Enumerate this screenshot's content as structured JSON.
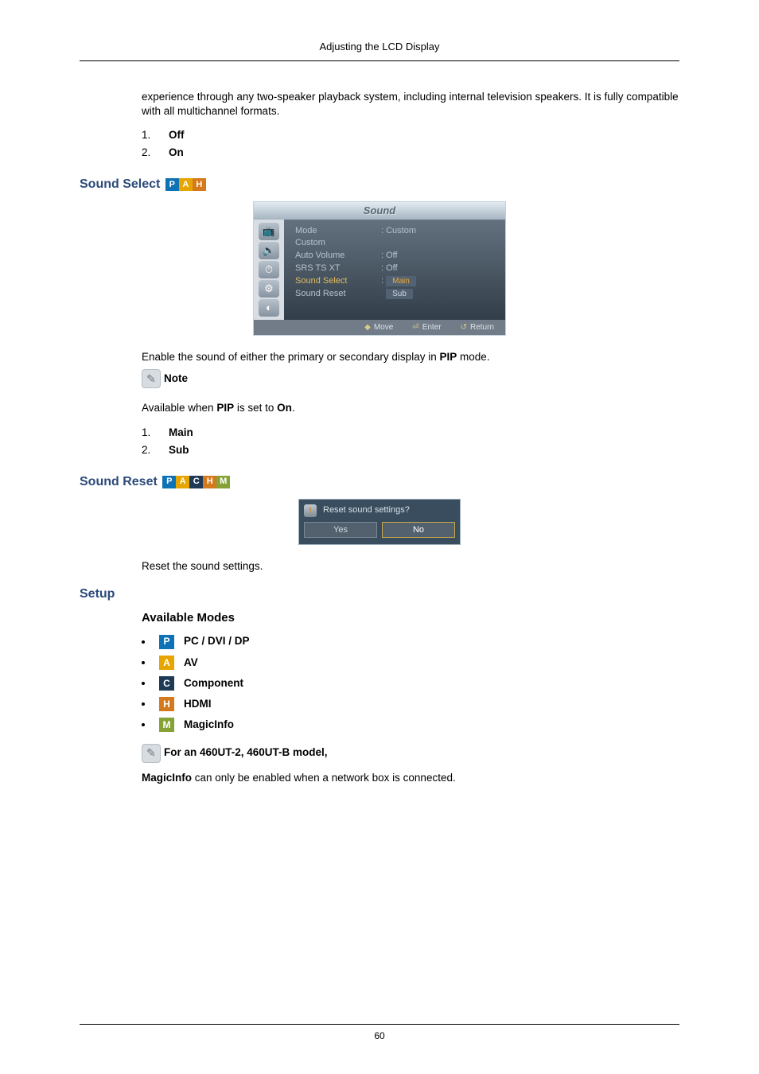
{
  "header": "Adjusting the LCD Display",
  "intro_paragraph": "experience through any two-speaker playback system, including internal television speakers. It is fully compatible with all multichannel formats.",
  "list_off_on": [
    "Off",
    "On"
  ],
  "sound_select": {
    "title": "Sound Select",
    "icons": [
      "P",
      "A",
      "H"
    ],
    "osd": {
      "title": "Sound",
      "rows": [
        {
          "k": "Mode",
          "v": ": Custom"
        },
        {
          "k": "Custom",
          "v": ""
        },
        {
          "k": "Auto Volume",
          "v": ": Off"
        },
        {
          "k": "SRS TS XT",
          "v": ": Off"
        },
        {
          "k": "Sound Select",
          "v_main": "Main",
          "highlight": true
        },
        {
          "k": "Sound Reset",
          "v_sub": "Sub"
        }
      ],
      "footer": {
        "move": "Move",
        "enter": "Enter",
        "return": "Return"
      }
    },
    "after_text": "Enable the sound of either the primary or secondary display in ",
    "after_bold": "PIP",
    "after_tail": " mode.",
    "note_label": "Note",
    "avail_pre": "Available when ",
    "avail_b1": "PIP",
    "avail_mid": " is set to ",
    "avail_b2": "On",
    "avail_tail": ".",
    "options": [
      "Main",
      "Sub"
    ]
  },
  "sound_reset": {
    "title": "Sound Reset",
    "icons": [
      "P",
      "A",
      "C",
      "H",
      "M"
    ],
    "dlg_text": "Reset sound settings?",
    "dlg_yes": "Yes",
    "dlg_no": "No",
    "after": "Reset the sound settings."
  },
  "setup": {
    "title": "Setup",
    "modes_title": "Available Modes",
    "modes": [
      {
        "letter": "P",
        "label": "PC / DVI / DP"
      },
      {
        "letter": "A",
        "label": "AV"
      },
      {
        "letter": "C",
        "label": "Component"
      },
      {
        "letter": "H",
        "label": "HDMI"
      },
      {
        "letter": "M",
        "label": "MagicInfo"
      }
    ],
    "note_bold": "For an 460UT-2, 460UT-B model,",
    "magic_pre": "MagicInfo",
    "magic_tail": " can only be enabled when a network box is connected."
  },
  "page_number": "60"
}
